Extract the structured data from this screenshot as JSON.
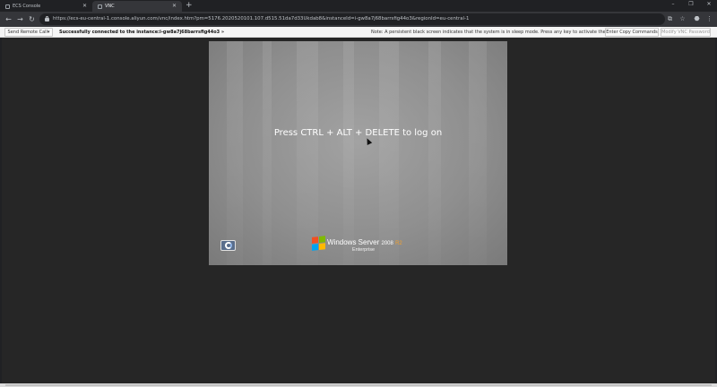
{
  "browser": {
    "tabs": [
      {
        "title": "ECS Console",
        "active": false
      },
      {
        "title": "VNC",
        "active": true
      }
    ],
    "new_tab_icon": "plus-icon",
    "url": "https://ecs-eu-central-1.console.aliyun.com/vnc/index.htm?pm=5176.2020520101.107.d515.51da7d33Ukdab8&instanceId=i-gw8a7j68barrsfig44o3&regionId=eu-central-1",
    "icons": [
      "back-icon",
      "forward-icon",
      "reload-icon",
      "lock-icon",
      "translate-icon",
      "star-icon",
      "extensions-icon",
      "menu-icon"
    ]
  },
  "vnc_bar": {
    "send_remote_call": "Send Remote Call▾",
    "status": "Successfully connected to the instance:i-gw8a7j68barrsfig44o3 »",
    "note": "Note: A persistent black screen indicates that the system is in sleep mode. Press any key to activate the system.",
    "enter_copy_commands": "Enter Copy Commands",
    "modify_vnc_password": "Modify VNC Password"
  },
  "remote_screen": {
    "logon_prompt": "Press CTRL + ALT + DELETE to log on",
    "brand_name": "Windows Server",
    "brand_version": "2008",
    "brand_release": "R2",
    "edition": "Enterprise"
  },
  "colors": {
    "browser_frame": "#202124",
    "toolbar": "#35363a",
    "vnc_bg": "#262626",
    "screen_gray": "#8f8f8f"
  }
}
